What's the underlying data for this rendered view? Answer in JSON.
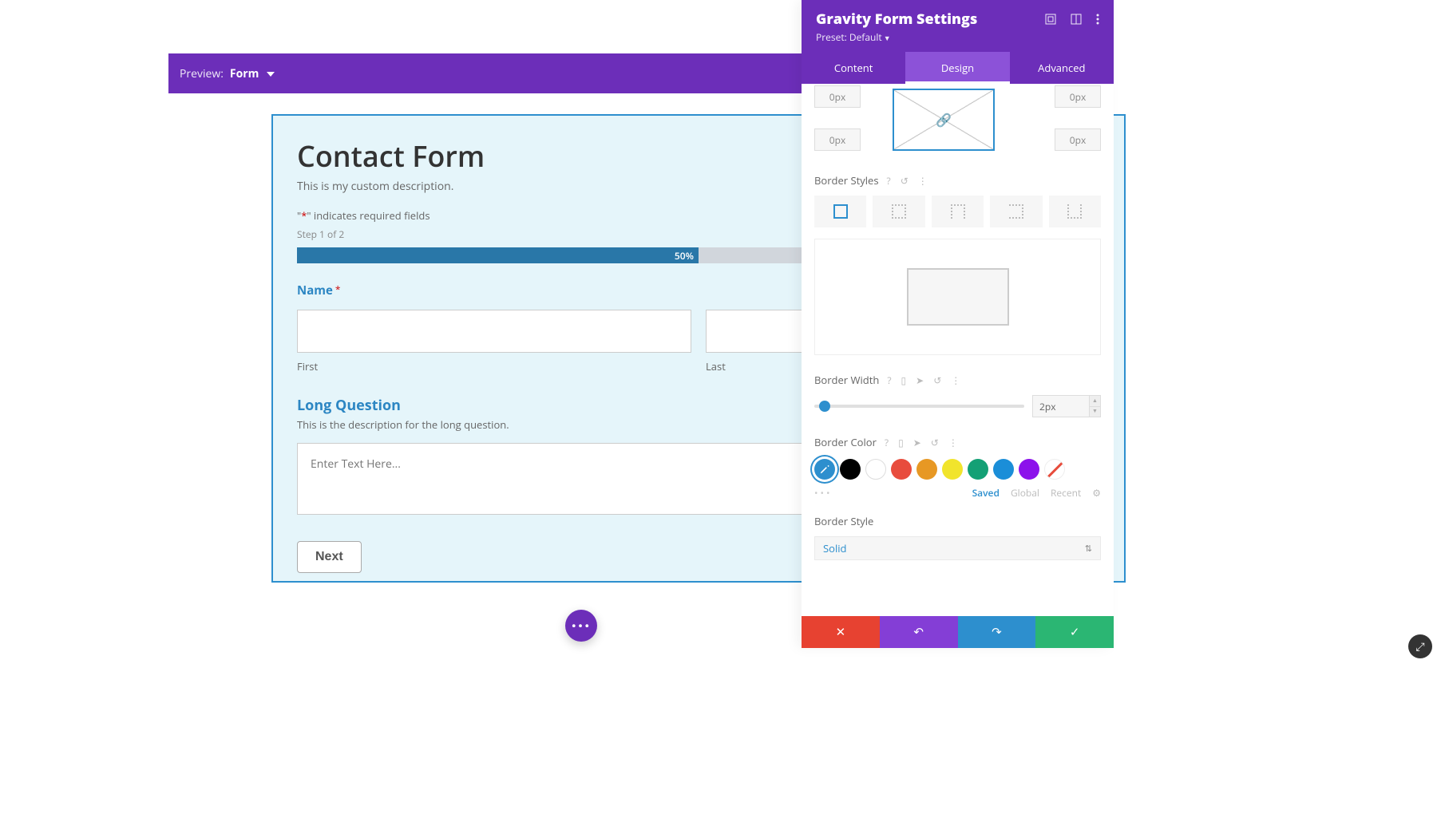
{
  "preview": {
    "label": "Preview:",
    "form": "Form"
  },
  "form": {
    "title": "Contact Form",
    "description": "This is my custom description.",
    "required_note_pre": "\"",
    "required_note_post": "\" indicates required fields",
    "step_text": "Step 1 of 2",
    "progress_pct": "50%",
    "name_label": "Name",
    "first_label": "First",
    "last_label": "Last",
    "long_q_label": "Long Question",
    "long_q_desc": "This is the description for the long question.",
    "textarea_placeholder": "Enter Text Here...",
    "next_label": "Next"
  },
  "panel": {
    "title": "Gravity Form Settings",
    "preset_label": "Preset: Default",
    "tabs": {
      "content": "Content",
      "design": "Design",
      "advanced": "Advanced"
    },
    "margin": {
      "tl": "0px",
      "tr": "0px",
      "bl": "0px",
      "br": "0px"
    },
    "sections": {
      "border_styles": "Border Styles",
      "border_width": "Border Width",
      "border_color": "Border Color",
      "border_style": "Border Style"
    },
    "border_width_value": "2px",
    "color_tabs": {
      "saved": "Saved",
      "global": "Global",
      "recent": "Recent"
    },
    "swatches": [
      {
        "name": "picker",
        "hex": "#2d8fce"
      },
      {
        "name": "black",
        "hex": "#000000"
      },
      {
        "name": "white",
        "hex": "#ffffff"
      },
      {
        "name": "red",
        "hex": "#e84c3d"
      },
      {
        "name": "orange",
        "hex": "#e79824"
      },
      {
        "name": "yellow",
        "hex": "#f1e42c"
      },
      {
        "name": "green",
        "hex": "#14a075"
      },
      {
        "name": "blue",
        "hex": "#1b8ed8"
      },
      {
        "name": "purple",
        "hex": "#8c12eb"
      },
      {
        "name": "none",
        "hex": "none"
      }
    ],
    "border_style_value": "Solid"
  }
}
